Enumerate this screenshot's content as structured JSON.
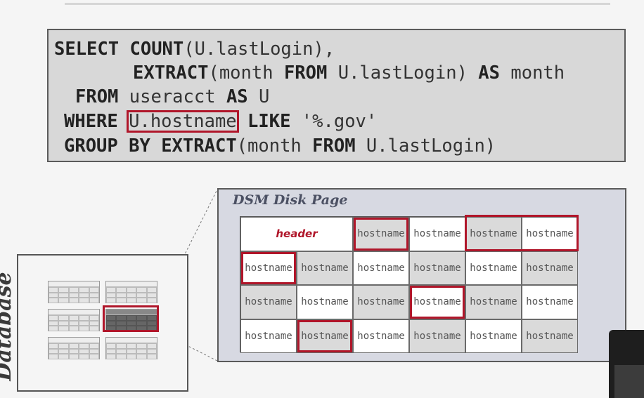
{
  "sql": {
    "line1": {
      "kw1": "SELECT",
      "kw2": "COUNT",
      "rest": "(U.lastLogin),"
    },
    "line2": {
      "kw1": "EXTRACT",
      "rest1": "(month ",
      "kw2": "FROM",
      "rest2": " U.lastLogin) ",
      "kw3": "AS",
      "rest3": " month"
    },
    "line3": {
      "kw1": "FROM",
      "rest1": " useracct ",
      "kw2": "AS",
      "rest2": " U"
    },
    "line4": {
      "kw1": "WHERE",
      "highlight": "U.hostname",
      "kw2": "LIKE",
      "rest": " '%.gov'"
    },
    "line5": {
      "kw1": "GROUP",
      "kw2": "BY",
      "kw3": "EXTRACT",
      "rest1": "(month ",
      "kw4": "FROM",
      "rest2": " U.lastLogin)"
    }
  },
  "database_file": {
    "label": "Database File"
  },
  "dsm_page": {
    "title": "DSM Disk Page",
    "header_label": "header",
    "cell_label": "hostname"
  },
  "colors": {
    "highlight": "#b0162a",
    "page_bg": "#d7d9e2",
    "sql_bg": "#d8d8d8"
  }
}
